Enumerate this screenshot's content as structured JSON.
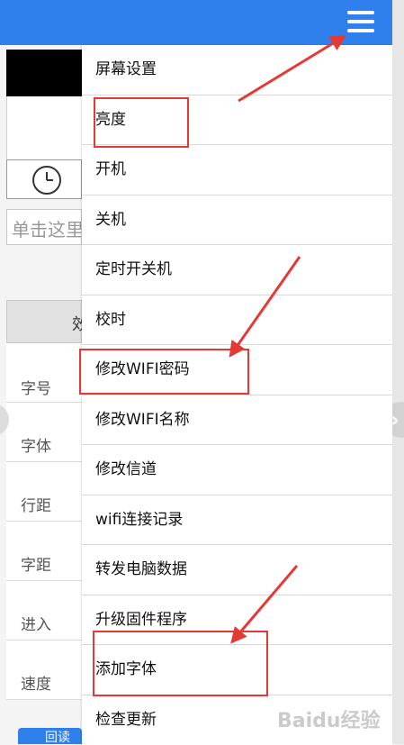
{
  "background": {
    "text_input_hint": "单击这里",
    "effect_header": "效",
    "settings_labels": [
      "字号",
      "字体",
      "行距",
      "字距",
      "进入",
      "速度"
    ],
    "bottom_button": "回读"
  },
  "menu": {
    "items": [
      "屏幕设置",
      "亮度",
      "开机",
      "关机",
      "定时开关机",
      "校时",
      "修改WIFI密码",
      "修改WIFI名称",
      "修改信道",
      "wifi连接记录",
      "转发电脑数据",
      "升级固件程序",
      "添加字体",
      "检查更新"
    ]
  },
  "watermark": "Baidu经验",
  "colors": {
    "topbar": "#2f80ed",
    "annotation": "#e53935"
  }
}
